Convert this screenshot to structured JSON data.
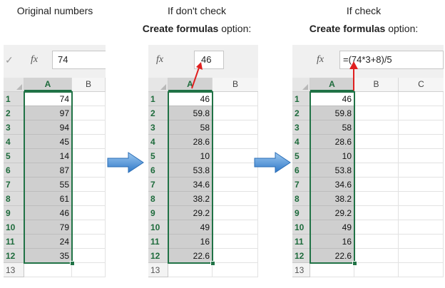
{
  "captions": {
    "left": "Original numbers",
    "middle_line1": "If don't check",
    "middle_line2_bold": "Create formulas",
    "middle_line2_rest": " option:",
    "right_line1": "If check",
    "right_line2_bold": "Create formulas",
    "right_line2_rest": " option:"
  },
  "formula_bar": {
    "fx": "fx",
    "check": "✓"
  },
  "columns": {
    "a": "A",
    "b": "B",
    "c": "C"
  },
  "row_numbers": [
    "1",
    "2",
    "3",
    "4",
    "5",
    "6",
    "7",
    "8",
    "9",
    "10",
    "11",
    "12",
    "13"
  ],
  "panels": {
    "original": {
      "formula_value": "74",
      "values": [
        "74",
        "97",
        "94",
        "45",
        "14",
        "87",
        "55",
        "61",
        "46",
        "79",
        "24",
        "35"
      ]
    },
    "unchecked": {
      "formula_value": "46",
      "values": [
        "46",
        "59.8",
        "58",
        "28.6",
        "10",
        "53.8",
        "34.6",
        "38.2",
        "29.2",
        "49",
        "16",
        "22.6"
      ]
    },
    "checked": {
      "formula_value": "=(74*3+8)/5",
      "values": [
        "46",
        "59.8",
        "58",
        "28.6",
        "10",
        "53.8",
        "34.6",
        "38.2",
        "29.2",
        "49",
        "16",
        "22.6"
      ]
    }
  },
  "colors": {
    "accent_green": "#217346",
    "arrow_blue": "#4a90d9",
    "callout_red": "#e02020"
  }
}
